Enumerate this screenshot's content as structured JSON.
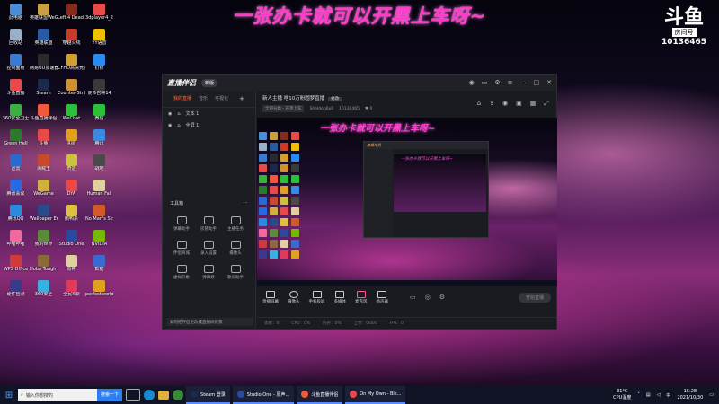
{
  "overlay": {
    "banner": "一张办卡就可以开黑上车呀~",
    "room_logo": "斗鱼",
    "room_label": "房间号",
    "room_id": "10136465"
  },
  "desktop_icons": [
    {
      "label": "此电脑",
      "color": "#4a8ed8"
    },
    {
      "label": "英雄联盟WeGame版",
      "color": "#c8a040"
    },
    {
      "label": "Left 4 Dead 2",
      "color": "#8a2a1a"
    },
    {
      "label": "3dplayer4_2",
      "color": "#e84a4a"
    },
    {
      "label": "回收站",
      "color": "#9ab0c8"
    },
    {
      "label": "英雄联盟",
      "color": "#2a5aa0"
    },
    {
      "label": "穿越火线",
      "color": "#c83a2a"
    },
    {
      "label": "YY语音",
      "color": "#f0c000"
    },
    {
      "label": "控制面板",
      "color": "#3a7ad0"
    },
    {
      "label": "网易UU加速器",
      "color": "#2a2a2a"
    },
    {
      "label": "CFHD高清竞技大区",
      "color": "#d0a030"
    },
    {
      "label": "钉钉",
      "color": "#2a8af0"
    },
    {
      "label": "斗鱼直播",
      "color": "#e84a4a"
    },
    {
      "label": "Steam",
      "color": "#1a2a4a"
    },
    {
      "label": "Counter-Strike Global Of...",
      "color": "#d09030"
    },
    {
      "label": "使命召唤14",
      "color": "#3a3a3a"
    },
    {
      "label": "360安全卫士",
      "color": "#3ab040"
    },
    {
      "label": "斗鱼直播伴侣",
      "color": "#f05a3a"
    },
    {
      "label": "WeChat",
      "color": "#2ac03a"
    },
    {
      "label": "微信",
      "color": "#2ac03a"
    },
    {
      "label": "Green Hell",
      "color": "#2a7a2a"
    },
    {
      "label": "斗鱼",
      "color": "#e84a4a"
    },
    {
      "label": "R星",
      "color": "#e0a020"
    },
    {
      "label": "腾讯",
      "color": "#3a8ae0"
    },
    {
      "label": "迅雷",
      "color": "#2a6ad0"
    },
    {
      "label": "海贼王",
      "color": "#c84a2a"
    },
    {
      "label": "奇迹",
      "color": "#d0c040"
    },
    {
      "label": "战地",
      "color": "#4a4a4a"
    },
    {
      "label": "腾讯会议",
      "color": "#2a6ae0"
    },
    {
      "label": "WeGame",
      "color": "#d0b040"
    },
    {
      "label": "DYA",
      "color": "#e84a4a"
    },
    {
      "label": "Human Fall",
      "color": "#e0d0a0"
    },
    {
      "label": "腾讯QQ",
      "color": "#2a8ae0"
    },
    {
      "label": "Wallpaper Engine",
      "color": "#2a4a8a"
    },
    {
      "label": "鹅鸭杀",
      "color": "#e0c040"
    },
    {
      "label": "No Man's Sky",
      "color": "#d05a2a"
    },
    {
      "label": "哔哩哔哩",
      "color": "#f06aa0"
    },
    {
      "label": "我的世界",
      "color": "#5a8a3a"
    },
    {
      "label": "Studio One",
      "color": "#2a4aa0"
    },
    {
      "label": "NVIDIA",
      "color": "#76b900"
    },
    {
      "label": "WPS Office",
      "color": "#d03a3a"
    },
    {
      "label": "Hobo Tough Life",
      "color": "#8a6a3a"
    },
    {
      "label": "原神",
      "color": "#e0d0a0"
    },
    {
      "label": "数据",
      "color": "#3a6ad0"
    },
    {
      "label": "硬件检测",
      "color": "#3a3a8a"
    },
    {
      "label": "360安全",
      "color": "#3ab0e0"
    },
    {
      "label": "全民K歌",
      "color": "#e03a5a"
    },
    {
      "label": "perfectworld",
      "color": "#e0a020"
    }
  ],
  "app": {
    "title": "直播伴侣",
    "version": "新版",
    "left_tabs": [
      "我的直播",
      "音乐",
      "可视化"
    ],
    "sources": [
      "文本 1",
      "全屏 1"
    ],
    "tools_title": "工具箱",
    "tools": [
      "弹幕助手",
      "房管助手",
      "主播任务",
      "伴侣商城",
      "录入设置",
      "摄像头",
      "虚拟形象",
      "弹幕姬",
      "歌词助手"
    ],
    "notice": "如何把伴侣更改成直播间背景",
    "room_title": "新人主播 啥10万粉圆梦直播",
    "room_tag": "修改",
    "category": "全部分类 - 开黑上车",
    "streamer": "Sheldon0x0",
    "room_no": "10136465",
    "follows": "0",
    "preview_banner": "一张办卡就可以开黑上车呀~",
    "controls": [
      "直播屏幕",
      "摄像头",
      "手机投屏",
      "多媒体",
      "麦克风",
      "扬声器"
    ],
    "start_live": "开始直播",
    "status": [
      "丢帧：0",
      "CPU：0%",
      "内存：0%",
      "上传：0kb/s",
      "FPS：0"
    ]
  },
  "taskbar": {
    "search_placeholder": "输入你想搜的",
    "search_button": "搜索一下",
    "apps": [
      {
        "label": "Steam 登录",
        "color": "#1a2a4a"
      },
      {
        "label": "Studio One - 原声...",
        "color": "#2a4aa0"
      },
      {
        "label": "斗鱼直播伴侣",
        "color": "#f05a3a"
      },
      {
        "label": "On My Own - Blk...",
        "color": "#e84a4a"
      }
    ],
    "weather": "31°C",
    "weather_sub": "CPU温度",
    "time": "15:28",
    "date": "2021/10/30"
  }
}
